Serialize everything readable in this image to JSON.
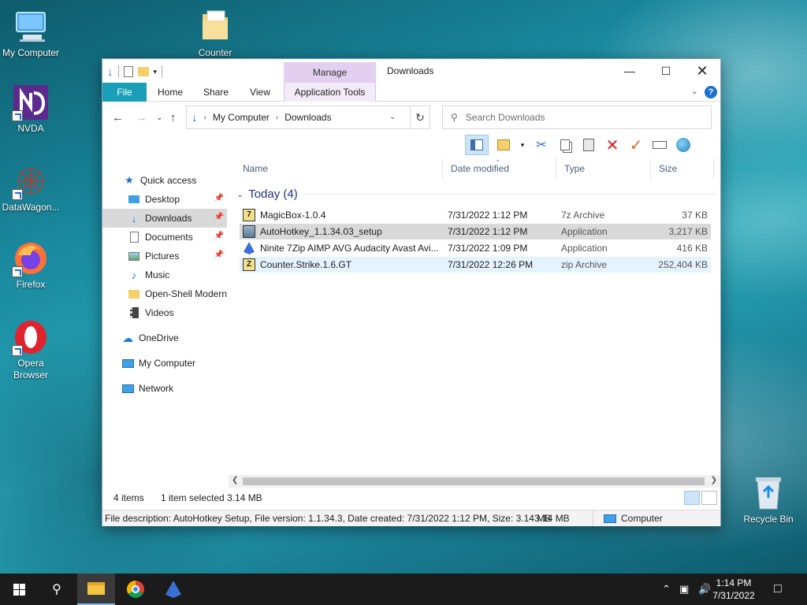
{
  "desktop": {
    "icons": [
      {
        "label": "My Computer"
      },
      {
        "label": "Counter"
      },
      {
        "label": "NVDA"
      },
      {
        "label": "DataWagon..."
      },
      {
        "label": "Firefox"
      },
      {
        "label": "Opera Browser"
      },
      {
        "label": "Recycle Bin"
      }
    ]
  },
  "window": {
    "title": "Downloads",
    "manage_tab": "Manage",
    "tabs": [
      "File",
      "Home",
      "Share",
      "View",
      "Application Tools"
    ],
    "help": "?",
    "address": {
      "segments": [
        "My Computer",
        "Downloads"
      ]
    },
    "search_placeholder": "Search Downloads",
    "columns": [
      "Name",
      "Date modified",
      "Type",
      "Size"
    ],
    "group_label": "Today (4)",
    "files": [
      {
        "name": "MagicBox-1.0.4",
        "date": "7/31/2022 1:12 PM",
        "type": "7z Archive",
        "size": "37 KB"
      },
      {
        "name": "AutoHotkey_1.1.34.03_setup",
        "date": "7/31/2022 1:12 PM",
        "type": "Application",
        "size": "3,217 KB"
      },
      {
        "name": "Ninite 7Zip AIMP AVG Audacity Avast Avi...",
        "date": "7/31/2022 1:09 PM",
        "type": "Application",
        "size": "416 KB"
      },
      {
        "name": "Counter.Strike.1.6.GT",
        "date": "7/31/2022 12:26 PM",
        "type": "zip Archive",
        "size": "252,404 KB"
      }
    ],
    "nav": {
      "quick_access": "Quick access",
      "items": [
        "Desktop",
        "Downloads",
        "Documents",
        "Pictures",
        "Music",
        "Open-Shell Modern",
        "Videos"
      ],
      "onedrive": "OneDrive",
      "my_computer": "My Computer",
      "network": "Network"
    },
    "status": {
      "items": "4 items",
      "selected": "1 item selected",
      "size": "3.14 MB",
      "description": "File description: AutoHotkey Setup, File version: 1.1.34.3, Date created: 7/31/2022 1:12 PM, Size: 3.14 MB",
      "desc_size": "3.14 MB",
      "location": "Computer"
    }
  },
  "taskbar": {
    "time": "1:14 PM",
    "date": "7/31/2022"
  }
}
